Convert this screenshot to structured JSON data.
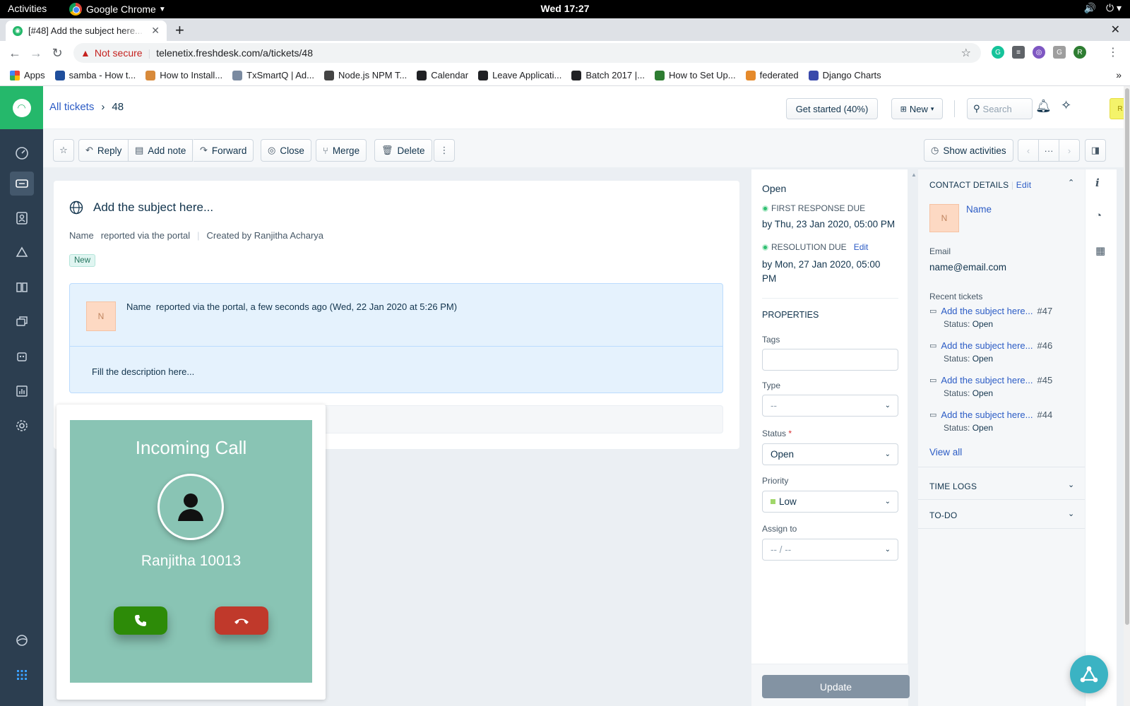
{
  "os": {
    "activities": "Activities",
    "app_name": "Google Chrome",
    "clock": "Wed 17:27"
  },
  "browser": {
    "tab_title": "[#48] Add the subject here...",
    "security": "Not secure",
    "url": "telenetix.freshdesk.com/a/tickets/48",
    "bookmarks": [
      {
        "label": "Apps",
        "color": "#4285f4"
      },
      {
        "label": "samba - How t...",
        "color": "#1f4e9c"
      },
      {
        "label": "How to Install...",
        "color": "#d88a3a"
      },
      {
        "label": "TxSmartQ | Ad...",
        "color": "#7a8aa0"
      },
      {
        "label": "Node.js NPM T...",
        "color": "#444444"
      },
      {
        "label": "Calendar",
        "color": "#202124"
      },
      {
        "label": "Leave Applicati...",
        "color": "#202124"
      },
      {
        "label": "Batch 2017 |...",
        "color": "#202124"
      },
      {
        "label": "How to Set Up...",
        "color": "#2e7d32"
      },
      {
        "label": "federated",
        "color": "#e58a2b"
      },
      {
        "label": "Django Charts",
        "color": "#3949ab"
      }
    ]
  },
  "header": {
    "breadcrumb_root": "All tickets",
    "breadcrumb_id": "48",
    "get_started": "Get started (40%)",
    "new_label": "New",
    "search_placeholder": "Search",
    "avatar_initial": "R"
  },
  "actions": {
    "reply": "Reply",
    "add_note": "Add note",
    "forward": "Forward",
    "close": "Close",
    "merge": "Merge",
    "delete": "Delete",
    "show_activities": "Show activities"
  },
  "ticket": {
    "subject": "Add the subject here...",
    "reporter": "Name",
    "reported_via": "reported via the portal",
    "created_by": "Created by Ranjitha Acharya",
    "status_badge": "New",
    "message": {
      "avatar": "N",
      "name": "Name",
      "line": "reported via the portal, a few seconds ago (Wed, 22 Jan 2020 at 5:26 PM)",
      "body": "Fill the description here..."
    }
  },
  "call": {
    "title": "Incoming Call",
    "caller": "Ranjitha 10013"
  },
  "properties": {
    "state": "Open",
    "first_response_label": "FIRST RESPONSE DUE",
    "first_response_due": "by Thu, 23 Jan 2020, 05:00 PM",
    "resolution_label": "RESOLUTION DUE",
    "resolution_edit": "Edit",
    "resolution_due_line1": "by Mon, 27 Jan 2020, 05:00",
    "resolution_due_line2": "PM",
    "section_title": "PROPERTIES",
    "tags_label": "Tags",
    "type_label": "Type",
    "type_value": "--",
    "status_label": "Status",
    "required_mark": "*",
    "status_value": "Open",
    "priority_label": "Priority",
    "priority_value": "Low",
    "assign_label": "Assign to",
    "assign_value": "-- / --",
    "update": "Update"
  },
  "contact": {
    "title": "CONTACT DETAILS",
    "edit": "Edit",
    "avatar": "N",
    "name": "Name",
    "email_label": "Email",
    "email": "name@email.com",
    "recent_label": "Recent tickets",
    "recent": [
      {
        "subject": "Add the subject here...",
        "id": "#47",
        "status_label": "Status:",
        "status": "Open"
      },
      {
        "subject": "Add the subject here...",
        "id": "#46",
        "status_label": "Status:",
        "status": "Open"
      },
      {
        "subject": "Add the subject here...",
        "id": "#45",
        "status_label": "Status:",
        "status": "Open"
      },
      {
        "subject": "Add the subject here...",
        "id": "#44",
        "status_label": "Status:",
        "status": "Open"
      }
    ],
    "view_all": "View all",
    "time_logs": "TIME LOGS",
    "todo": "TO-DO"
  }
}
